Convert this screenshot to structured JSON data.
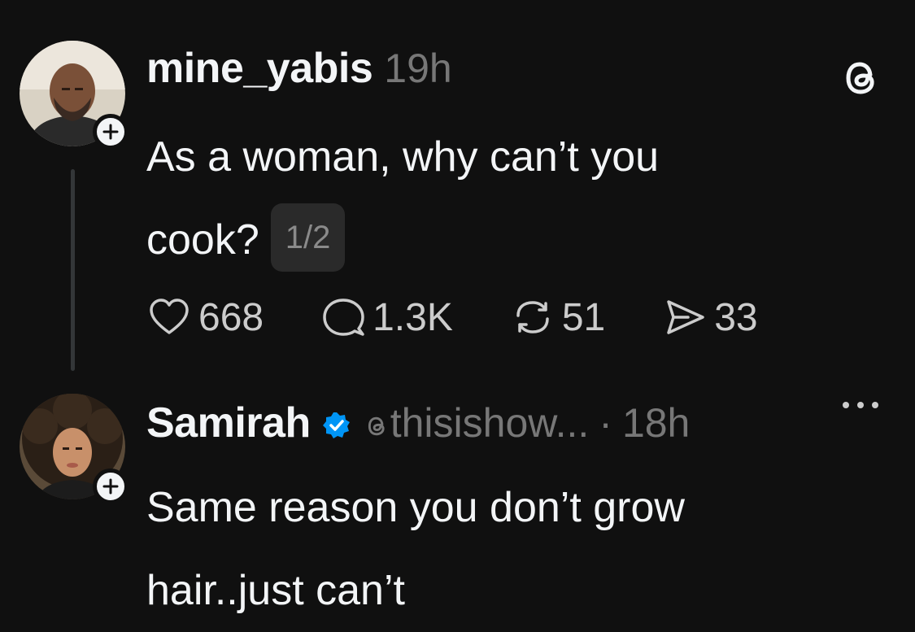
{
  "post": {
    "username": "mine_yabis",
    "timestamp": "19h",
    "text_line1": "As a woman, why can’t you",
    "text_line2": "cook?",
    "page_indicator": "1/2",
    "stats": {
      "likes": "668",
      "replies": "1.3K",
      "reposts": "51",
      "shares": "33"
    }
  },
  "reply": {
    "username": "Samirah",
    "handle": "thisishow...",
    "separator": "·",
    "timestamp": "18h",
    "text_line1": "Same reason you don’t grow",
    "text_line2": "hair..just can’t"
  },
  "icons": {
    "app_logo": "threads-logo-icon",
    "follow": "plus-icon",
    "like": "heart-icon",
    "reply": "comment-icon",
    "repost": "repost-icon",
    "share": "send-icon",
    "verified": "verified-badge-icon",
    "more": "more-options-icon"
  },
  "colors": {
    "background": "#101010",
    "primary_text": "#f3f5f7",
    "secondary_text": "#777777",
    "verified": "#0095f6"
  }
}
